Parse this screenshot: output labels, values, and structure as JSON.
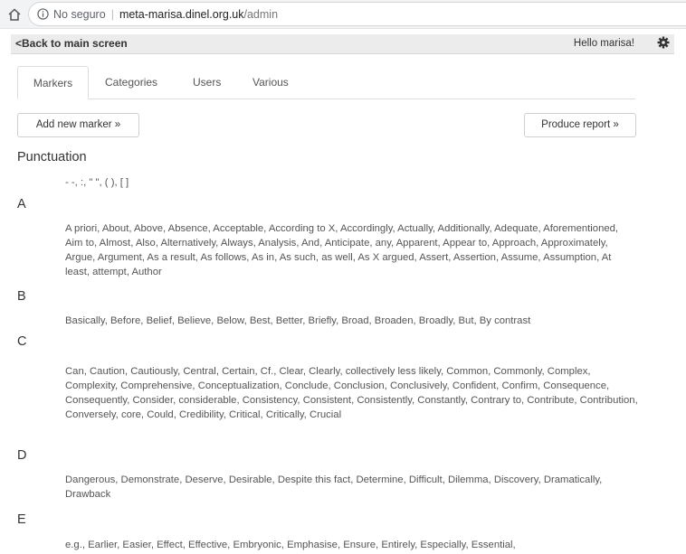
{
  "browser": {
    "security_text": "No seguro",
    "host": "meta-marisa.dinel.org.uk",
    "path": "/admin"
  },
  "topnav": {
    "back_label": "Back to main screen",
    "greeting": "Hello marisa!"
  },
  "tabs": [
    {
      "label": "Markers",
      "active": true
    },
    {
      "label": "Categories",
      "active": false
    },
    {
      "label": "Users",
      "active": false
    },
    {
      "label": "Various",
      "active": false
    }
  ],
  "actions": {
    "add_marker": "Add new marker »",
    "produce_report": "Produce report »"
  },
  "sections": [
    {
      "title": "Punctuation",
      "items": "- -, :, \" \", ( ), [ ]"
    },
    {
      "title": "A",
      "items": "A priori, About, Above, Absence, Acceptable, According to X, Accordingly, Actually, Additionally, Adequate, Aforementioned, Aim to, Almost, Also, Alternatively, Always, Analysis, And, Anticipate, any, Apparent, Appear to, Approach, Approximately, Argue, Argument, As a result, As follows, As in, As such, as well, As X argued, Assert, Assertion, Assume, Assumption, At least, attempt, Author"
    },
    {
      "title": "B",
      "items": "Basically, Before, Belief, Believe, Below, Best, Better, Briefly, Broad, Broaden, Broadly, But, By contrast"
    },
    {
      "title": "C",
      "items": "Can, Caution, Cautiously, Central, Certain, Cf., Clear, Clearly, collectively less likely, Common, Commonly, Complex, Complexity, Comprehensive, Conceptualization, Conclude, Conclusion, Conclusively, Confident, Confirm, Consequence, Consequently, Consider, considerable, Consistency, Consistent, Consistently, Constantly, Contrary to, Contribute, Contribution, Conversely, core, Could, Credibility, Critical, Critically, Crucial"
    },
    {
      "title": "D",
      "items": "Dangerous, Demonstrate, Deserve, Desirable, Despite this fact, Determine, Difficult, Dilemma, Discovery, Dramatically, Drawback"
    },
    {
      "title": "E",
      "items": "e.g., Earlier, Easier, Effect, Effective, Embryonic, Emphasise, Ensure, Entirely, Especially, Essential,"
    }
  ]
}
